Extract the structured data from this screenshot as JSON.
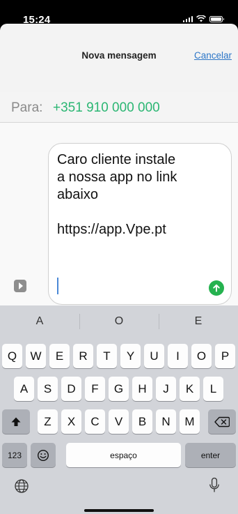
{
  "status_bar": {
    "time": "15:24"
  },
  "nav": {
    "title": "Nova mensagem",
    "cancel_label": "Cancelar"
  },
  "recipient": {
    "label": "Para:",
    "value": "+351 910 000 000"
  },
  "message": {
    "text": "Caro cliente instale\na nossa app no link\nabaixo\n\nhttps://app.Vpe.pt"
  },
  "keyboard": {
    "predictions": [
      "A",
      "O",
      "E"
    ],
    "row1": [
      "Q",
      "W",
      "E",
      "R",
      "T",
      "Y",
      "U",
      "I",
      "O",
      "P"
    ],
    "row2": [
      "A",
      "S",
      "D",
      "F",
      "G",
      "H",
      "J",
      "K",
      "L"
    ],
    "row3": [
      "Z",
      "X",
      "C",
      "V",
      "B",
      "N",
      "M"
    ],
    "numbers_label": "123",
    "space_label": "espaço",
    "enter_label": "enter"
  },
  "colors": {
    "accent_green": "#2bb673",
    "send_green": "#25b24f",
    "link_blue": "#2d76c7",
    "keyboard_bg": "#d2d4d9"
  },
  "icons": [
    "signal-icon",
    "wifi-icon",
    "battery-icon",
    "apps-icon",
    "send-arrow-icon",
    "shift-icon",
    "backspace-icon",
    "emoji-icon",
    "globe-icon",
    "microphone-icon"
  ]
}
